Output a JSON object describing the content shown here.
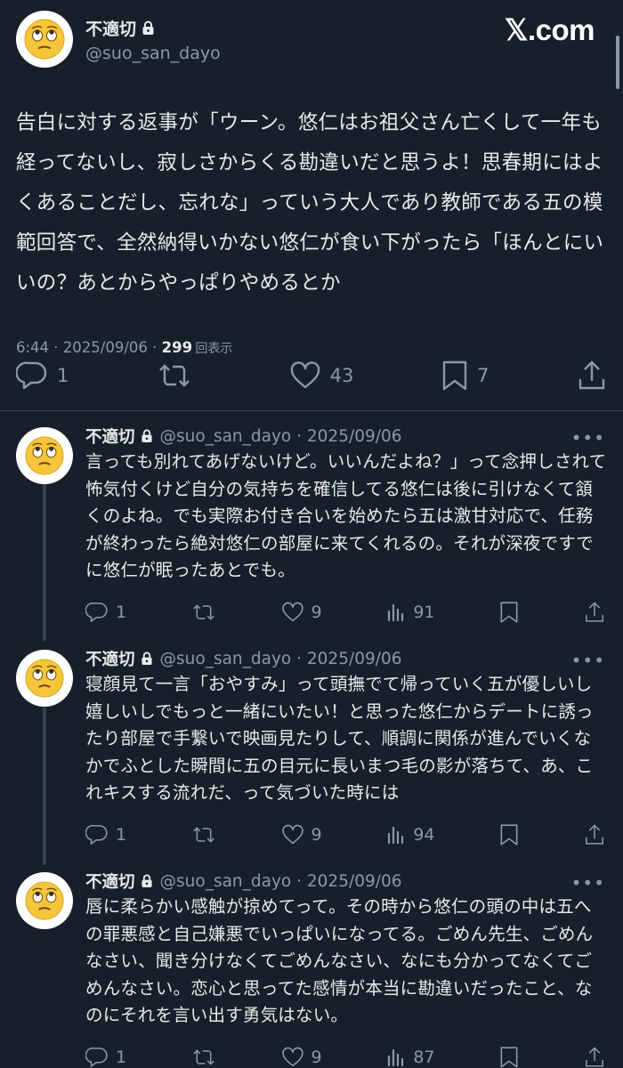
{
  "brand": "𝕏.com",
  "main": {
    "display_name": "不適切",
    "handle": "@suo_san_dayo",
    "text": "告白に対する返事が「ウーン。悠仁はお祖父さん亡くして一年も経ってないし、寂しさからくる勘違いだと思うよ！思春期にはよくあることだし、忘れな」っていう大人であり教師である五の模範回答で、全然納得いかない悠仁が食い下がったら「ほんとにいいの？あとからやっぱりやめるとか",
    "time": "6:44 · 2025/09/06 · ",
    "views": "299",
    "views_label": "回表示",
    "replies": "1",
    "retweets": "",
    "likes": "43",
    "bookmarks": "7"
  },
  "replies": [
    {
      "display_name": "不適切",
      "handle": "@suo_san_dayo · 2025/09/06",
      "text": "言っても別れてあげないけど。いいんだよね？」って念押しされて怖気付くけど自分の気持ちを確信してる悠仁は後に引けなくて頷くのよね。でも実際お付き合いを始めたら五は激甘対応で、任務が終わったら絶対悠仁の部屋に来てくれるの。それが深夜ですでに悠仁が眠ったあとでも。",
      "replies": "1",
      "likes": "9",
      "views": "91"
    },
    {
      "display_name": "不適切",
      "handle": "@suo_san_dayo · 2025/09/06",
      "text": "寝顔見て一言「おやすみ」って頭撫でて帰っていく五が優しいし嬉しいしでもっと一緒にいたい！と思った悠仁からデートに誘ったり部屋で手繋いで映画見たりして、順調に関係が進んでいくなかでふとした瞬間に五の目元に長いまつ毛の影が落ちて、あ、これキスする流れだ、って気づいた時には",
      "replies": "1",
      "likes": "9",
      "views": "94"
    },
    {
      "display_name": "不適切",
      "handle": "@suo_san_dayo · 2025/09/06",
      "text": "唇に柔らかい感触が掠めてって。その時から悠仁の頭の中は五への罪悪感と自己嫌悪でいっぱいになってる。ごめん先生、ごめんなさい、聞き分けなくてごめんなさい、なにも分かってなくてごめんなさい。恋心と思ってた感情が本当に勘違いだったこと、なのにそれを言い出す勇気はない。",
      "replies": "1",
      "likes": "9",
      "views": "87"
    }
  ],
  "colors": {
    "background": "#15202b",
    "text": "#e7e9ea",
    "muted": "#8b98a5",
    "divider": "#38444d"
  }
}
